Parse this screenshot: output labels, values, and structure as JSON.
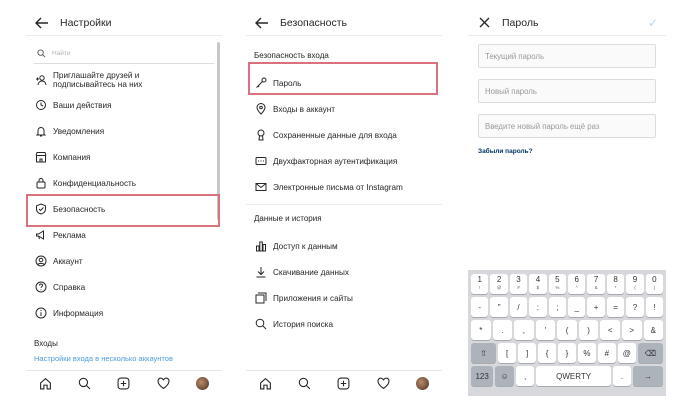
{
  "settings": {
    "title": "Настройки",
    "search_placeholder": "Найти",
    "items": [
      {
        "label": "Приглашайте друзей и",
        "label2": "подписывайтесь на них",
        "icon": "add-person-icon"
      },
      {
        "label": "Ваши действия",
        "icon": "activity-icon"
      },
      {
        "label": "Уведомления",
        "icon": "bell-icon"
      },
      {
        "label": "Компания",
        "icon": "shop-icon"
      },
      {
        "label": "Конфиденциальность",
        "icon": "lock-icon"
      },
      {
        "label": "Безопасность",
        "icon": "shield-icon"
      },
      {
        "label": "Реклама",
        "icon": "megaphone-icon"
      },
      {
        "label": "Аккаунт",
        "icon": "account-icon"
      },
      {
        "label": "Справка",
        "icon": "help-icon"
      },
      {
        "label": "Информация",
        "icon": "info-icon"
      }
    ],
    "logins_section": "Входы",
    "multi_account_link": "Настройки входа в несколько аккаунтов"
  },
  "security": {
    "title": "Безопасность",
    "login_section": "Безопасность входа",
    "login_items": [
      {
        "label": "Пароль",
        "icon": "key-icon"
      },
      {
        "label": "Входы в аккаунт",
        "icon": "location-pin-icon"
      },
      {
        "label": "Сохраненные данные для входа",
        "icon": "keyhole-icon"
      },
      {
        "label": "Двухфакторная аутентификация",
        "icon": "phone-code-icon"
      },
      {
        "label": "Электронные письма от Instagram",
        "icon": "mail-icon"
      }
    ],
    "data_section": "Данные и история",
    "data_items": [
      {
        "label": "Доступ к данным",
        "icon": "bar-chart-icon"
      },
      {
        "label": "Скачивание данных",
        "icon": "download-icon"
      },
      {
        "label": "Приложения и сайты",
        "icon": "apps-icon"
      },
      {
        "label": "История поиска",
        "icon": "search-icon"
      }
    ]
  },
  "password": {
    "title": "Пароль",
    "current_placeholder": "Текущий пароль",
    "new_placeholder": "Новый пароль",
    "repeat_placeholder": "Введите новый пароль ещё раз",
    "forgot_link": "Забыли пароль?",
    "keyboard": {
      "digits": [
        "1",
        "2",
        "3",
        "4",
        "5",
        "6",
        "7",
        "8",
        "9",
        "0"
      ],
      "digit_subs": [
        "!",
        "@",
        "#",
        "$",
        "%",
        "^",
        "&",
        "*",
        "(",
        ")"
      ],
      "row2": [
        "-",
        "\"",
        "/",
        ":",
        ";",
        "_",
        "+",
        "=",
        "?",
        "!"
      ],
      "row3": [
        "*",
        ".",
        ",",
        "'",
        "(",
        ")",
        "<",
        ">",
        "&"
      ],
      "row4": [
        "[",
        "]",
        "{",
        "}",
        "%",
        "#",
        "@"
      ],
      "mode_label": "123",
      "space_label": "QWERTY"
    }
  },
  "colors": {
    "highlight": "#d9727c",
    "link": "#4b9bdb",
    "keyboard_bg": "#d6d8dc"
  }
}
